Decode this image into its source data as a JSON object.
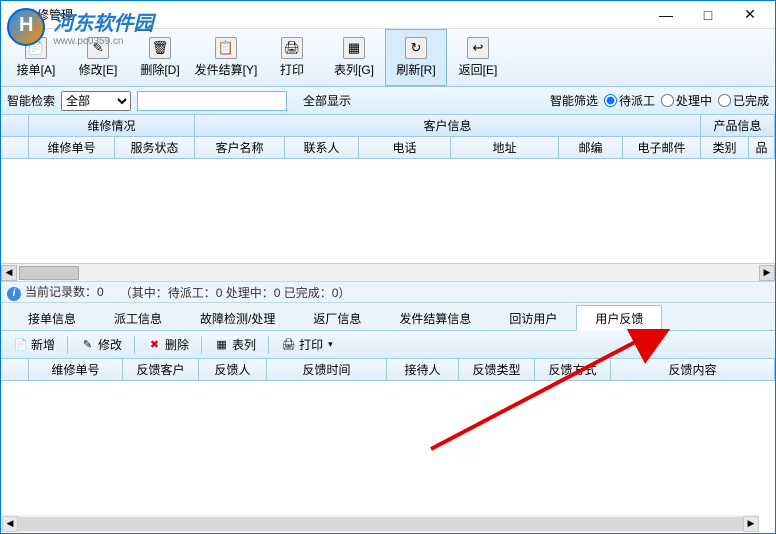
{
  "window": {
    "title": "维修管理"
  },
  "watermark": {
    "cn": "河东软件园",
    "url": "www.pc0359.cn"
  },
  "toolbar": {
    "receive": "接单[A]",
    "modify": "修改[E]",
    "delete": "删除[D]",
    "dispatch": "发件结算[Y]",
    "print": "打印",
    "columns": "表列[G]",
    "refresh": "刷新[R]",
    "back": "返回[E]"
  },
  "filter": {
    "smart_label": "智能检索",
    "scope": "全部",
    "show_all": "全部显示",
    "smart_filter": "智能筛选",
    "opt_pending": "待派工",
    "opt_processing": "处理中",
    "opt_done": "已完成"
  },
  "grid_top": {
    "group1": "维修情况",
    "group2": "客户信息",
    "group3": "产品信息",
    "cols": {
      "order_no": "维修单号",
      "status": "服务状态",
      "cust_name": "客户名称",
      "contact": "联系人",
      "phone": "电话",
      "address": "地址",
      "zip": "邮编",
      "email": "电子邮件",
      "category": "类别",
      "brand": "品"
    }
  },
  "status": {
    "count": "当前记录数：0",
    "detail": "（其中：待派工：0   处理中：0   已完成：0）"
  },
  "tabs": {
    "t1": "接单信息",
    "t2": "派工信息",
    "t3": "故障检测/处理",
    "t4": "返厂信息",
    "t5": "发件结算信息",
    "t6": "回访用户",
    "t7": "用户反馈"
  },
  "sub_toolbar": {
    "add": "新增",
    "edit": "修改",
    "del": "删除",
    "cols": "表列",
    "print": "打印"
  },
  "grid_bottom": {
    "order_no": "维修单号",
    "fb_customer": "反馈客户",
    "fb_person": "反馈人",
    "fb_time": "反馈时间",
    "receiver": "接待人",
    "fb_type": "反馈类型",
    "fb_method": "反馈方式",
    "fb_content": "反馈内容"
  }
}
